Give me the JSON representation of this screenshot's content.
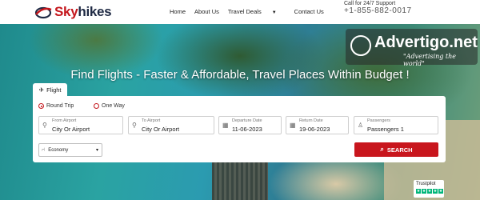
{
  "brand": {
    "sky": "Sky",
    "hikes": "hikes"
  },
  "nav": {
    "home": "Home",
    "about": "About Us",
    "travel_deals": "Travel Deals",
    "contact": "Contact Us"
  },
  "support": {
    "label": "Call for 24/7 Support",
    "phone": "+1-855-882-0017"
  },
  "watermark": {
    "main": "Advertigo.net",
    "tagline": "\"Advertising the world\""
  },
  "hero": {
    "title": "Find Flights - Faster & Affordable, Travel Places Within Budget !"
  },
  "search": {
    "tab": "Flight",
    "trip_types": [
      "Round Trip",
      "One Way"
    ],
    "selected_trip": "Round Trip",
    "from": {
      "label": "From Airport",
      "value": "City Or Airport"
    },
    "to": {
      "label": "To Airport",
      "value": "City Or Airport"
    },
    "departure": {
      "label": "Departure Date",
      "value": "11-06-2023"
    },
    "return": {
      "label": "Return Date",
      "value": "19-06-2023"
    },
    "passengers": {
      "label": "Passengers",
      "value": "Passengers 1"
    },
    "cabin": "Economy",
    "button": "SEARCH"
  },
  "trustpilot": {
    "label": "Trustpilot"
  },
  "colors": {
    "brand_red": "#c8161d",
    "navy": "#1f2a44",
    "trustpilot_green": "#00b67a"
  }
}
